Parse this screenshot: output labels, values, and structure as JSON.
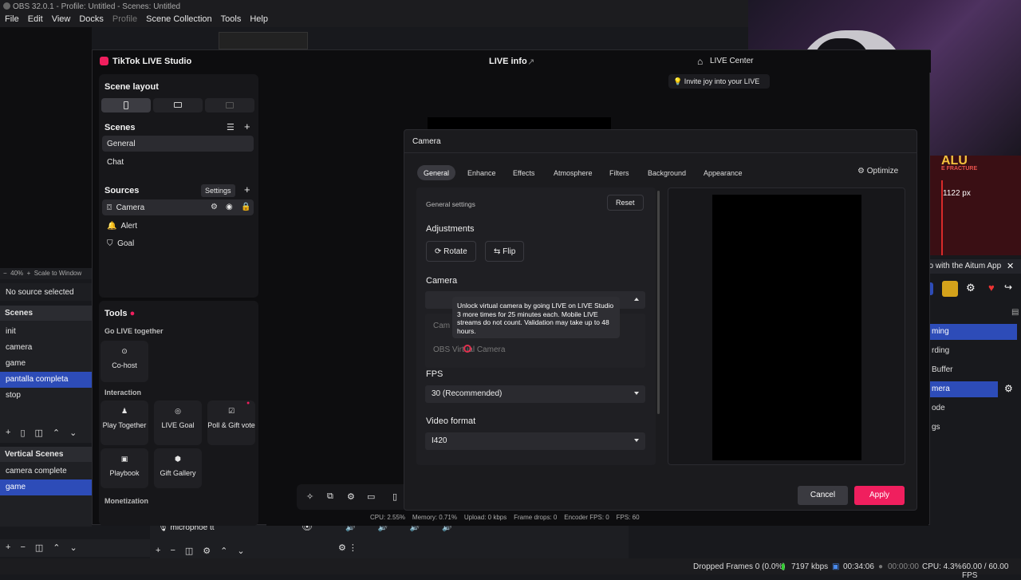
{
  "obs": {
    "title": "OBS 32.0.1 - Profile: Untitled - Scenes: Untitled",
    "menu": [
      "File",
      "Edit",
      "View",
      "Docks",
      "Profile",
      "Scene Collection",
      "Tools",
      "Help"
    ],
    "zoom": "40%",
    "scale_label": "Scale to Window",
    "no_source": "No source selected",
    "scenes_header": "Scenes",
    "scenes": [
      "init",
      "camera",
      "game",
      "pantalla completa",
      "stop"
    ],
    "selected_scene": "pantalla completa",
    "vertical_header": "Vertical Scenes",
    "vertical_scenes": [
      "camera complete",
      "game"
    ],
    "mixer_label": "microphoe tt",
    "game_overlay": {
      "title": "ALU",
      "subtitle": "E FRACTURE",
      "px": "1122 px"
    },
    "aitum_text": "go with the Aitum App",
    "controls": [
      "ming",
      "rding",
      "Buffer",
      "mera",
      "ode",
      "gs"
    ],
    "status": {
      "dropped": "Dropped Frames 0 (0.0%)",
      "kbps": "7197 kbps",
      "time1": "00:34:06",
      "time2": "00:00:00",
      "cpu": "CPU: 4.3%",
      "fps": "60.00 / 60.00 FPS"
    }
  },
  "tiktok": {
    "app_title": "TikTok LIVE Studio",
    "live_info": "LIVE info",
    "live_center": "LIVE Center",
    "invite": "Invite joy into your LIVE",
    "scene_layout": "Scene layout",
    "scenes_title": "Scenes",
    "scenes": [
      "General",
      "Chat"
    ],
    "sources_title": "Sources",
    "settings_tooltip": "Settings",
    "sources": [
      "Camera",
      "Alert",
      "Goal"
    ],
    "tools_title": "Tools",
    "go_live_together": "Go LIVE together",
    "cohost": "Co-host",
    "interaction": "Interaction",
    "interaction_tools": [
      "Play Together",
      "LIVE Goal",
      "Poll & Gift vote"
    ],
    "more_tools": [
      "Playbook",
      "Gift Gallery"
    ],
    "monetization": "Monetization",
    "stats": {
      "cpu": "CPU: 2.55%",
      "memory": "Memory: 0.71%",
      "upload": "Upload: 0 kbps",
      "frame_drops": "Frame drops: 0",
      "encoder_fps": "Encoder FPS: 0",
      "fps": "FPS: 60"
    }
  },
  "dialog": {
    "title": "Camera",
    "tabs": [
      "General",
      "Enhance",
      "Effects",
      "Atmosphere",
      "Filters",
      "Background",
      "Appearance"
    ],
    "active_tab": "General",
    "optimize": "Optimize",
    "general_settings": "General settings",
    "reset": "Reset",
    "adjustments": "Adjustments",
    "rotate": "Rotate",
    "flip": "Flip",
    "camera_label": "Camera",
    "camera_option_partial": "Cam",
    "virtual_camera": "OBS Virtual Camera",
    "tooltip": "Unlock virtual camera by going LIVE on LIVE Studio 3 more times for 25 minutes each. Mobile LIVE streams do not count. Validation may take up to 48 hours.",
    "fps_label": "FPS",
    "fps_value": "30 (Recommended)",
    "format_label": "Video format",
    "format_value": "I420",
    "cancel": "Cancel",
    "apply": "Apply"
  }
}
